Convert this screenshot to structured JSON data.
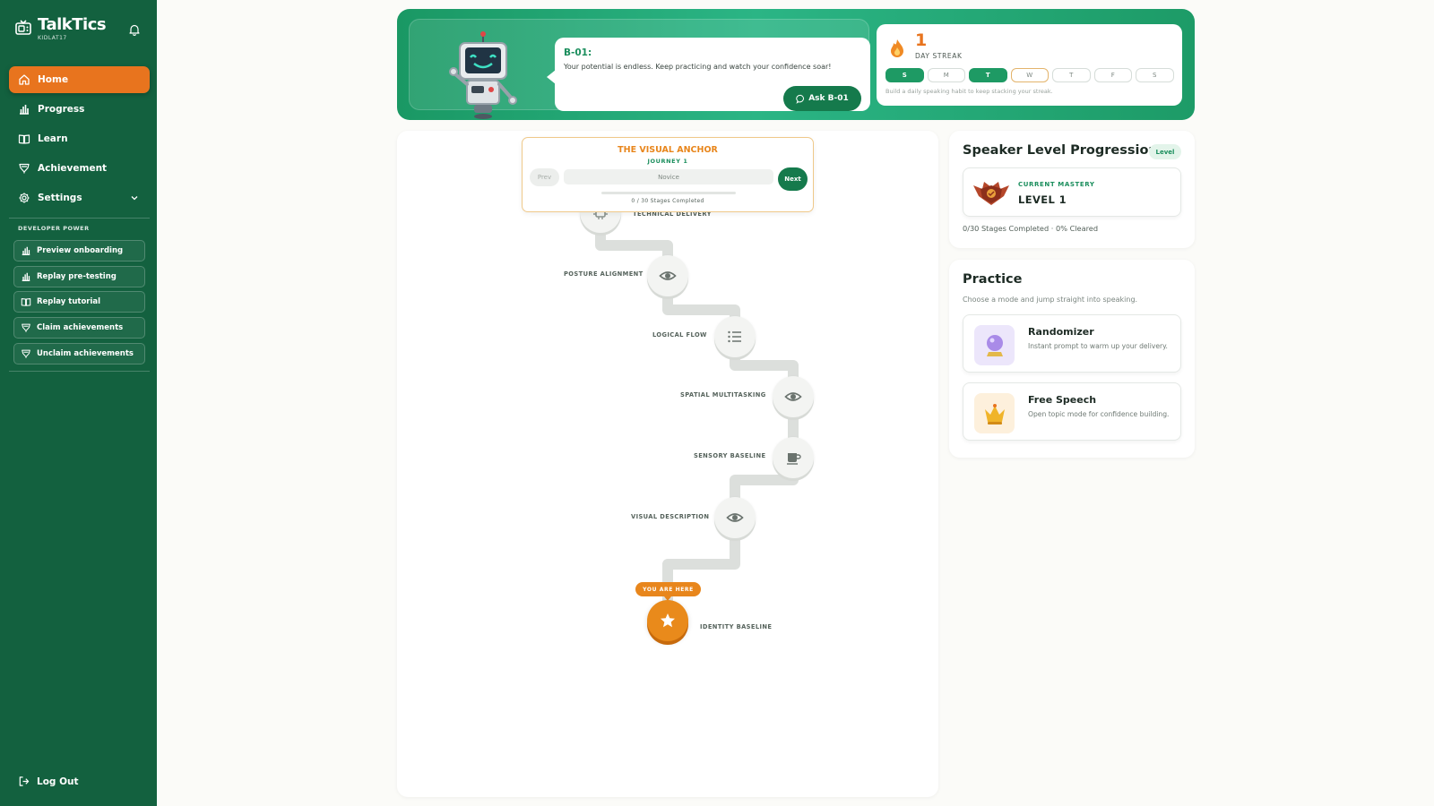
{
  "app": {
    "name": "TalkTics",
    "user": "KIDLAT17"
  },
  "nav": {
    "items": [
      {
        "label": "Home",
        "icon": "home-icon",
        "active": true
      },
      {
        "label": "Progress",
        "icon": "bar-chart-icon"
      },
      {
        "label": "Learn",
        "icon": "book-icon"
      },
      {
        "label": "Achievement",
        "icon": "trophy-icon"
      },
      {
        "label": "Settings",
        "icon": "gear-icon"
      }
    ]
  },
  "developer": {
    "title": "DEVELOPER POWER",
    "items": [
      {
        "label": "Preview onboarding",
        "icon": "bar-chart-icon"
      },
      {
        "label": "Replay pre-testing",
        "icon": "bar-chart-icon"
      },
      {
        "label": "Replay tutorial",
        "icon": "book-icon"
      },
      {
        "label": "Claim achievements",
        "icon": "trophy-icon"
      },
      {
        "label": "Unclaim achievements",
        "icon": "trophy-icon"
      }
    ]
  },
  "logout": {
    "label": "Log Out"
  },
  "assistant": {
    "name": "B-01:",
    "message": "Your potential is endless. Keep practicing and watch your confidence soar!",
    "button": "Ask B-01"
  },
  "streak": {
    "count": "1",
    "label": "DAY STREAK",
    "days": [
      "S",
      "M",
      "T",
      "W",
      "T",
      "F",
      "S"
    ],
    "done_days": [
      0,
      2
    ],
    "today_index": 3,
    "hint": "Build a daily speaking habit to keep stacking your streak."
  },
  "journey": {
    "title": "THE VISUAL ANCHOR",
    "subtitle": "JOURNEY 1",
    "prev": "Prev",
    "next": "Next",
    "level": "Novice",
    "count": "0 / 30 Stages Completed",
    "progress": 0,
    "you_are_here": "YOU ARE HERE",
    "stages": [
      {
        "label": "TECHNICAL DELIVERY",
        "icon": "chip-icon"
      },
      {
        "label": "POSTURE ALIGNMENT",
        "icon": "eye-icon"
      },
      {
        "label": "LOGICAL FLOW",
        "icon": "list-icon"
      },
      {
        "label": "SPATIAL MULTITASKING",
        "icon": "eye-icon"
      },
      {
        "label": "SENSORY BASELINE",
        "icon": "coffee-icon"
      },
      {
        "label": "VISUAL DESCRIPTION",
        "icon": "eye-icon"
      },
      {
        "label": "IDENTITY BASELINE",
        "icon": "star-icon",
        "current": true
      }
    ]
  },
  "level_card": {
    "title": "Speaker Level Progression",
    "badge": "Level",
    "mastery_caption": "CURRENT MASTERY",
    "mastery_level": "LEVEL 1",
    "stats": "0/30 Stages Completed  ·  0% Cleared"
  },
  "practice": {
    "title": "Practice",
    "description": "Choose a mode and jump straight into speaking.",
    "modes": [
      {
        "title": "Randomizer",
        "description": "Instant prompt to warm up your delivery.",
        "icon": "crystal-ball-icon"
      },
      {
        "title": "Free Speech",
        "description": "Open topic mode for confidence building.",
        "icon": "crown-icon"
      }
    ]
  },
  "colors": {
    "sidebar": "#13613f",
    "accent": "#e8741e",
    "brand_green": "#1e9a64"
  }
}
